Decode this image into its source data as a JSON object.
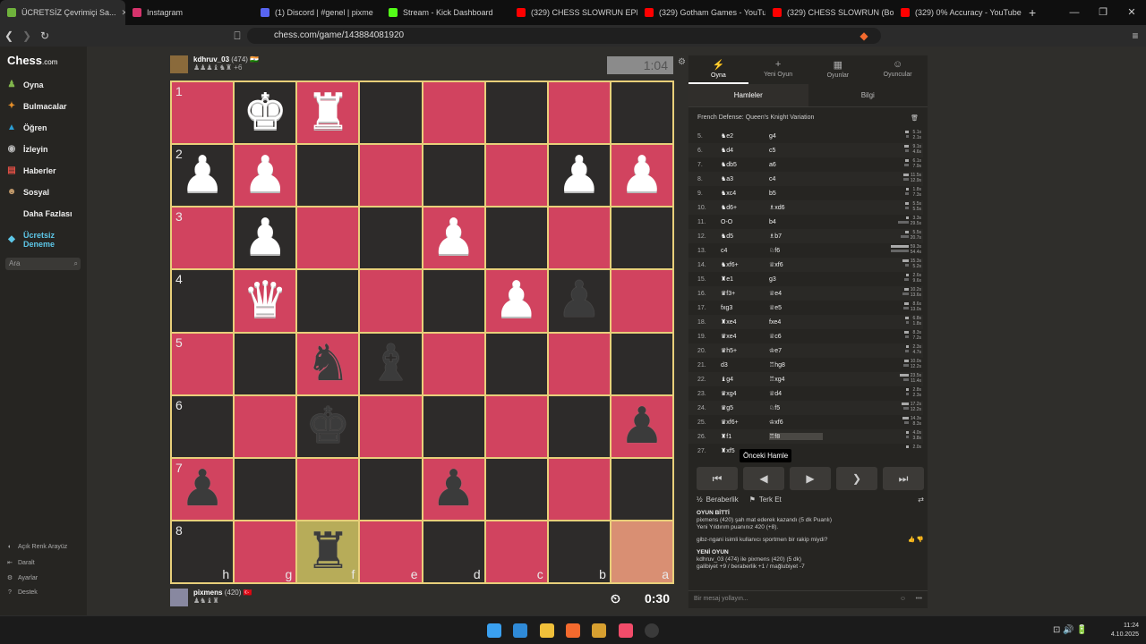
{
  "tabs": [
    {
      "title": "ÜCRETSİZ Çevrimiçi Sa...",
      "color": "#6fb23c",
      "active": true
    },
    {
      "title": "Instagram",
      "color": "#d6336c"
    },
    {
      "title": "(1) Discord | #genel | pixme",
      "color": "#5865f2"
    },
    {
      "title": "Stream - Kick Dashboard",
      "color": "#53fc18"
    },
    {
      "title": "(329) CHESS SLOWRUN EPISOD",
      "color": "#ff0000"
    },
    {
      "title": "(329) Gotham Games - YouTub",
      "color": "#ff0000"
    },
    {
      "title": "(329) CHESS SLOWRUN (Bonu",
      "color": "#ff0000"
    },
    {
      "title": "(329) 0% Accuracy - YouTube",
      "color": "#ff0000"
    }
  ],
  "url": "chess.com/game/143884081920",
  "sidebar": {
    "logo": "Chess",
    "logo_suffix": ".com",
    "items": [
      {
        "label": "Oyna",
        "icon": "♟",
        "color": "#81b64c"
      },
      {
        "label": "Bulmacalar",
        "icon": "✦",
        "color": "#e58f2a"
      },
      {
        "label": "Öğren",
        "icon": "▲",
        "color": "#2b9fd6"
      },
      {
        "label": "İzleyin",
        "icon": "◉",
        "color": "#bbbbbb"
      },
      {
        "label": "Haberler",
        "icon": "▤",
        "color": "#e04f45"
      },
      {
        "label": "Sosyal",
        "icon": "☻",
        "color": "#caa06f"
      },
      {
        "label": "Daha Fazlası",
        "icon": "•••",
        "color": "transparent"
      }
    ],
    "premium": "Ücretsiz Deneme",
    "search_placeholder": "Ara",
    "footer": [
      {
        "label": "Açık Renk Arayüz",
        "icon": "◐"
      },
      {
        "label": "Daralt",
        "icon": "⇤"
      },
      {
        "label": "Ayarlar",
        "icon": "⚙"
      },
      {
        "label": "Destek",
        "icon": "?"
      }
    ]
  },
  "top_player": {
    "name": "kdhruv_03",
    "rating": "(474)",
    "flag": "🇮🇳",
    "material": "+6"
  },
  "bottom_player": {
    "name": "pixmens",
    "rating": "(420)",
    "flag": "🇹🇷"
  },
  "clock_top": "1:04",
  "clock_bottom": "0:30",
  "board": {
    "ranks": [
      "1",
      "2",
      "3",
      "4",
      "5",
      "6",
      "7",
      "8"
    ],
    "files": [
      "h",
      "g",
      "f",
      "e",
      "d",
      "c",
      "b",
      "a"
    ],
    "rows": [
      [
        "",
        "wk",
        "wr",
        "",
        "",
        "",
        "",
        ""
      ],
      [
        "wp",
        "wp",
        "",
        "",
        "",
        "",
        "wp",
        "wp"
      ],
      [
        "",
        "wp",
        "",
        "",
        "wp",
        "",
        "",
        ""
      ],
      [
        "",
        "wq",
        "",
        "",
        "",
        "wp",
        "bp",
        ""
      ],
      [
        "",
        "",
        "bn",
        "bb",
        "",
        "",
        "",
        ""
      ],
      [
        "",
        "",
        "bk",
        "",
        "",
        "",
        "",
        "bp"
      ],
      [
        "bp",
        "",
        "",
        "",
        "bp",
        "",
        "",
        ""
      ],
      [
        "",
        "",
        "br",
        "",
        "",
        "",
        "",
        ""
      ]
    ]
  },
  "panel": {
    "tabs": [
      {
        "label": "Oyna",
        "icon": "⚡"
      },
      {
        "label": "Yeni Oyun",
        "icon": "+"
      },
      {
        "label": "Oyunlar",
        "icon": "▦"
      },
      {
        "label": "Oyuncular",
        "icon": "☺"
      }
    ],
    "subtabs": [
      "Hamleler",
      "Bilgi"
    ],
    "opening": "French Defense: Queen's Knight Variation",
    "moves": [
      [
        "5.",
        "♞e2",
        "g4",
        "5.1s",
        "2.1s"
      ],
      [
        "6.",
        "♞d4",
        "c5",
        "9.1s",
        "4.6s"
      ],
      [
        "7.",
        "♞db5",
        "a6",
        "6.1s",
        "7.9s"
      ],
      [
        "8.",
        "♞a3",
        "c4",
        "11.5s",
        "12.9s"
      ],
      [
        "9.",
        "♞xc4",
        "b5",
        "1.8s",
        "7.3s"
      ],
      [
        "10.",
        "♞d6+",
        "♗xd6",
        "5.5s",
        "5.5s"
      ],
      [
        "11.",
        "O-O",
        "b4",
        "3.3s",
        "29.5s"
      ],
      [
        "12.",
        "♞d5",
        "♗b7",
        "5.5s",
        "20.7s"
      ],
      [
        "13.",
        "c4",
        "♘f6",
        "59.3s",
        "54.4s"
      ],
      [
        "14.",
        "♞xf6+",
        "♕xf6",
        "15.3s",
        "5.2s"
      ],
      [
        "15.",
        "♜e1",
        "g3",
        "2.6s",
        "9.6s"
      ],
      [
        "16.",
        "♛f3+",
        "♕e4",
        "10.2s",
        "13.6s"
      ],
      [
        "17.",
        "fxg3",
        "♕e5",
        "8.6s",
        "13.0s"
      ],
      [
        "18.",
        "♜xe4",
        "fxe4",
        "6.8s",
        "1.8s"
      ],
      [
        "19.",
        "♛xe4",
        "♕c6",
        "8.3s",
        "7.2s"
      ],
      [
        "20.",
        "♛h5+",
        "♔e7",
        "2.3s",
        "4.7s"
      ],
      [
        "21.",
        "d3",
        "♖hg8",
        "10.0s",
        "12.2s"
      ],
      [
        "22.",
        "♝g4",
        "♖xg4",
        "23.5s",
        "11.4s"
      ],
      [
        "23.",
        "♛xg4",
        "♕d4",
        "2.8s",
        "2.3s"
      ],
      [
        "24.",
        "♛g5",
        "♘f5",
        "17.2s",
        "12.2s"
      ],
      [
        "25.",
        "♛xf6+",
        "♔xf6",
        "14.3s",
        "8.3s"
      ],
      [
        "26.",
        "♜f1",
        "♖f8",
        "4.0s",
        "3.8s"
      ],
      [
        "27.",
        "♜xf5",
        "",
        "2.0s",
        ""
      ]
    ],
    "tooltip": "Önceki Hamle",
    "controls": [
      "⏮",
      "◀",
      "▶",
      "❯",
      "⏭"
    ],
    "actions": {
      "draw": "Beraberlik",
      "resign": "Terk Et"
    },
    "chat": {
      "over": "OYUN BİTTİ",
      "result": "pixmens (420) şah mat ederek kazandı (5 dk Puanlı)",
      "rating": "Yeni Yıldırım puanınız 420 (+8).",
      "question": "gibz-ngani isimli kullanıcı sportmen bir rakip miydi?",
      "new": "YENİ OYUN",
      "newline": "kdhruv_03 (474) ile pixmens (420) (5 dk)",
      "record": "galibiyet +9 / beraberlik +1 / mağlubiyet -7"
    },
    "message_placeholder": "Bir mesaj yollayın..."
  },
  "taskbar": {
    "time": "11:24",
    "date": "4.10.2025"
  }
}
